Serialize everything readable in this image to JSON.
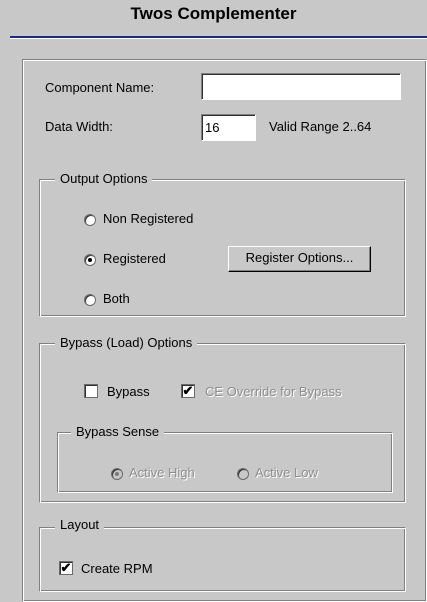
{
  "window": {
    "title": "Twos Complementer"
  },
  "fields": {
    "component_name_label": "Component Name:",
    "component_name_value": "",
    "data_width_label": "Data Width:",
    "data_width_value": "16",
    "data_width_hint": "Valid Range 2..64"
  },
  "output_options": {
    "legend": "Output Options",
    "non_registered": {
      "label": "Non Registered",
      "selected": false
    },
    "registered": {
      "label": "Registered",
      "selected": true
    },
    "both": {
      "label": "Both",
      "selected": false
    },
    "register_options_button": "Register Options..."
  },
  "bypass_options": {
    "legend": "Bypass (Load) Options",
    "bypass": {
      "label": "Bypass",
      "checked": false
    },
    "ce_override": {
      "label": "CE Override for Bypass",
      "checked": true,
      "enabled": false
    },
    "sense": {
      "legend": "Bypass Sense",
      "active_high": {
        "label": "Active High",
        "selected": true,
        "enabled": false
      },
      "active_low": {
        "label": "Active Low",
        "selected": false,
        "enabled": false
      }
    }
  },
  "layout": {
    "legend": "Layout",
    "create_rpm": {
      "label": "Create RPM",
      "checked": true
    }
  },
  "glyphs": {
    "checkmark": "✔"
  }
}
